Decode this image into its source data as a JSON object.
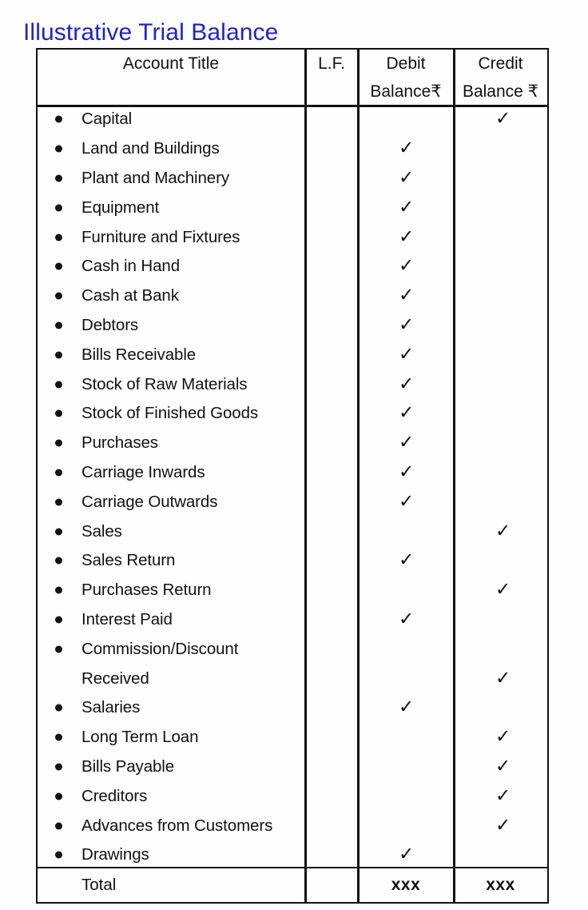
{
  "page": {
    "title": "Illustrative Trial Balance",
    "title_color": "#2222cc"
  },
  "table": {
    "columns": [
      {
        "key": "account_title",
        "label": "Account Title"
      },
      {
        "key": "lf",
        "label": "L.F."
      },
      {
        "key": "debit",
        "label_line1": "Debit",
        "label_line2": "Balance₹"
      },
      {
        "key": "credit",
        "label_line1": "Credit",
        "label_line2": "Balance ₹"
      }
    ],
    "tick_glyph": "✓",
    "bullet_glyph": "●",
    "rows": [
      {
        "account": "Capital",
        "lf": "",
        "debit": "",
        "credit": "✓"
      },
      {
        "account": "Land and Buildings",
        "lf": "",
        "debit": "✓",
        "credit": ""
      },
      {
        "account": "Plant and Machinery",
        "lf": "",
        "debit": "✓",
        "credit": ""
      },
      {
        "account": "Equipment",
        "lf": "",
        "debit": "✓",
        "credit": ""
      },
      {
        "account": "Furniture and Fixtures",
        "lf": "",
        "debit": "✓",
        "credit": ""
      },
      {
        "account": "Cash in Hand",
        "lf": "",
        "debit": "✓",
        "credit": ""
      },
      {
        "account": "Cash at Bank",
        "lf": "",
        "debit": "✓",
        "credit": ""
      },
      {
        "account": "Debtors",
        "lf": "",
        "debit": "✓",
        "credit": ""
      },
      {
        "account": "Bills Receivable",
        "lf": "",
        "debit": "✓",
        "credit": ""
      },
      {
        "account": "Stock of Raw Materials",
        "lf": "",
        "debit": "✓",
        "credit": ""
      },
      {
        "account": "Stock of Finished Goods",
        "lf": "",
        "debit": "✓",
        "credit": ""
      },
      {
        "account": "Purchases",
        "lf": "",
        "debit": "✓",
        "credit": ""
      },
      {
        "account": "Carriage Inwards",
        "lf": "",
        "debit": "✓",
        "credit": ""
      },
      {
        "account": "Carriage Outwards",
        "lf": "",
        "debit": "✓",
        "credit": ""
      },
      {
        "account": "Sales",
        "lf": "",
        "debit": "",
        "credit": "✓"
      },
      {
        "account": "Sales Return",
        "lf": "",
        "debit": "✓",
        "credit": ""
      },
      {
        "account": "Purchases Return",
        "lf": "",
        "debit": "",
        "credit": "✓"
      },
      {
        "account": "Interest Paid",
        "lf": "",
        "debit": "✓",
        "credit": ""
      },
      {
        "account": "Commission/Discount",
        "lf": "",
        "debit": "",
        "credit": ""
      },
      {
        "account": "Received",
        "lf": "",
        "debit": "",
        "credit": "✓",
        "continuation": true
      },
      {
        "account": "Salaries",
        "lf": "",
        "debit": "✓",
        "credit": ""
      },
      {
        "account": "Long Term Loan",
        "lf": "",
        "debit": "",
        "credit": "✓"
      },
      {
        "account": "Bills Payable",
        "lf": "",
        "debit": "",
        "credit": "✓"
      },
      {
        "account": "Creditors",
        "lf": "",
        "debit": "",
        "credit": "✓"
      },
      {
        "account": "Advances from Customers",
        "lf": "",
        "debit": "",
        "credit": "✓"
      },
      {
        "account": "Drawings",
        "lf": "",
        "debit": "✓",
        "credit": ""
      }
    ],
    "total": {
      "label": "Total",
      "lf": "",
      "debit": "xxx",
      "credit": "xxx"
    }
  }
}
